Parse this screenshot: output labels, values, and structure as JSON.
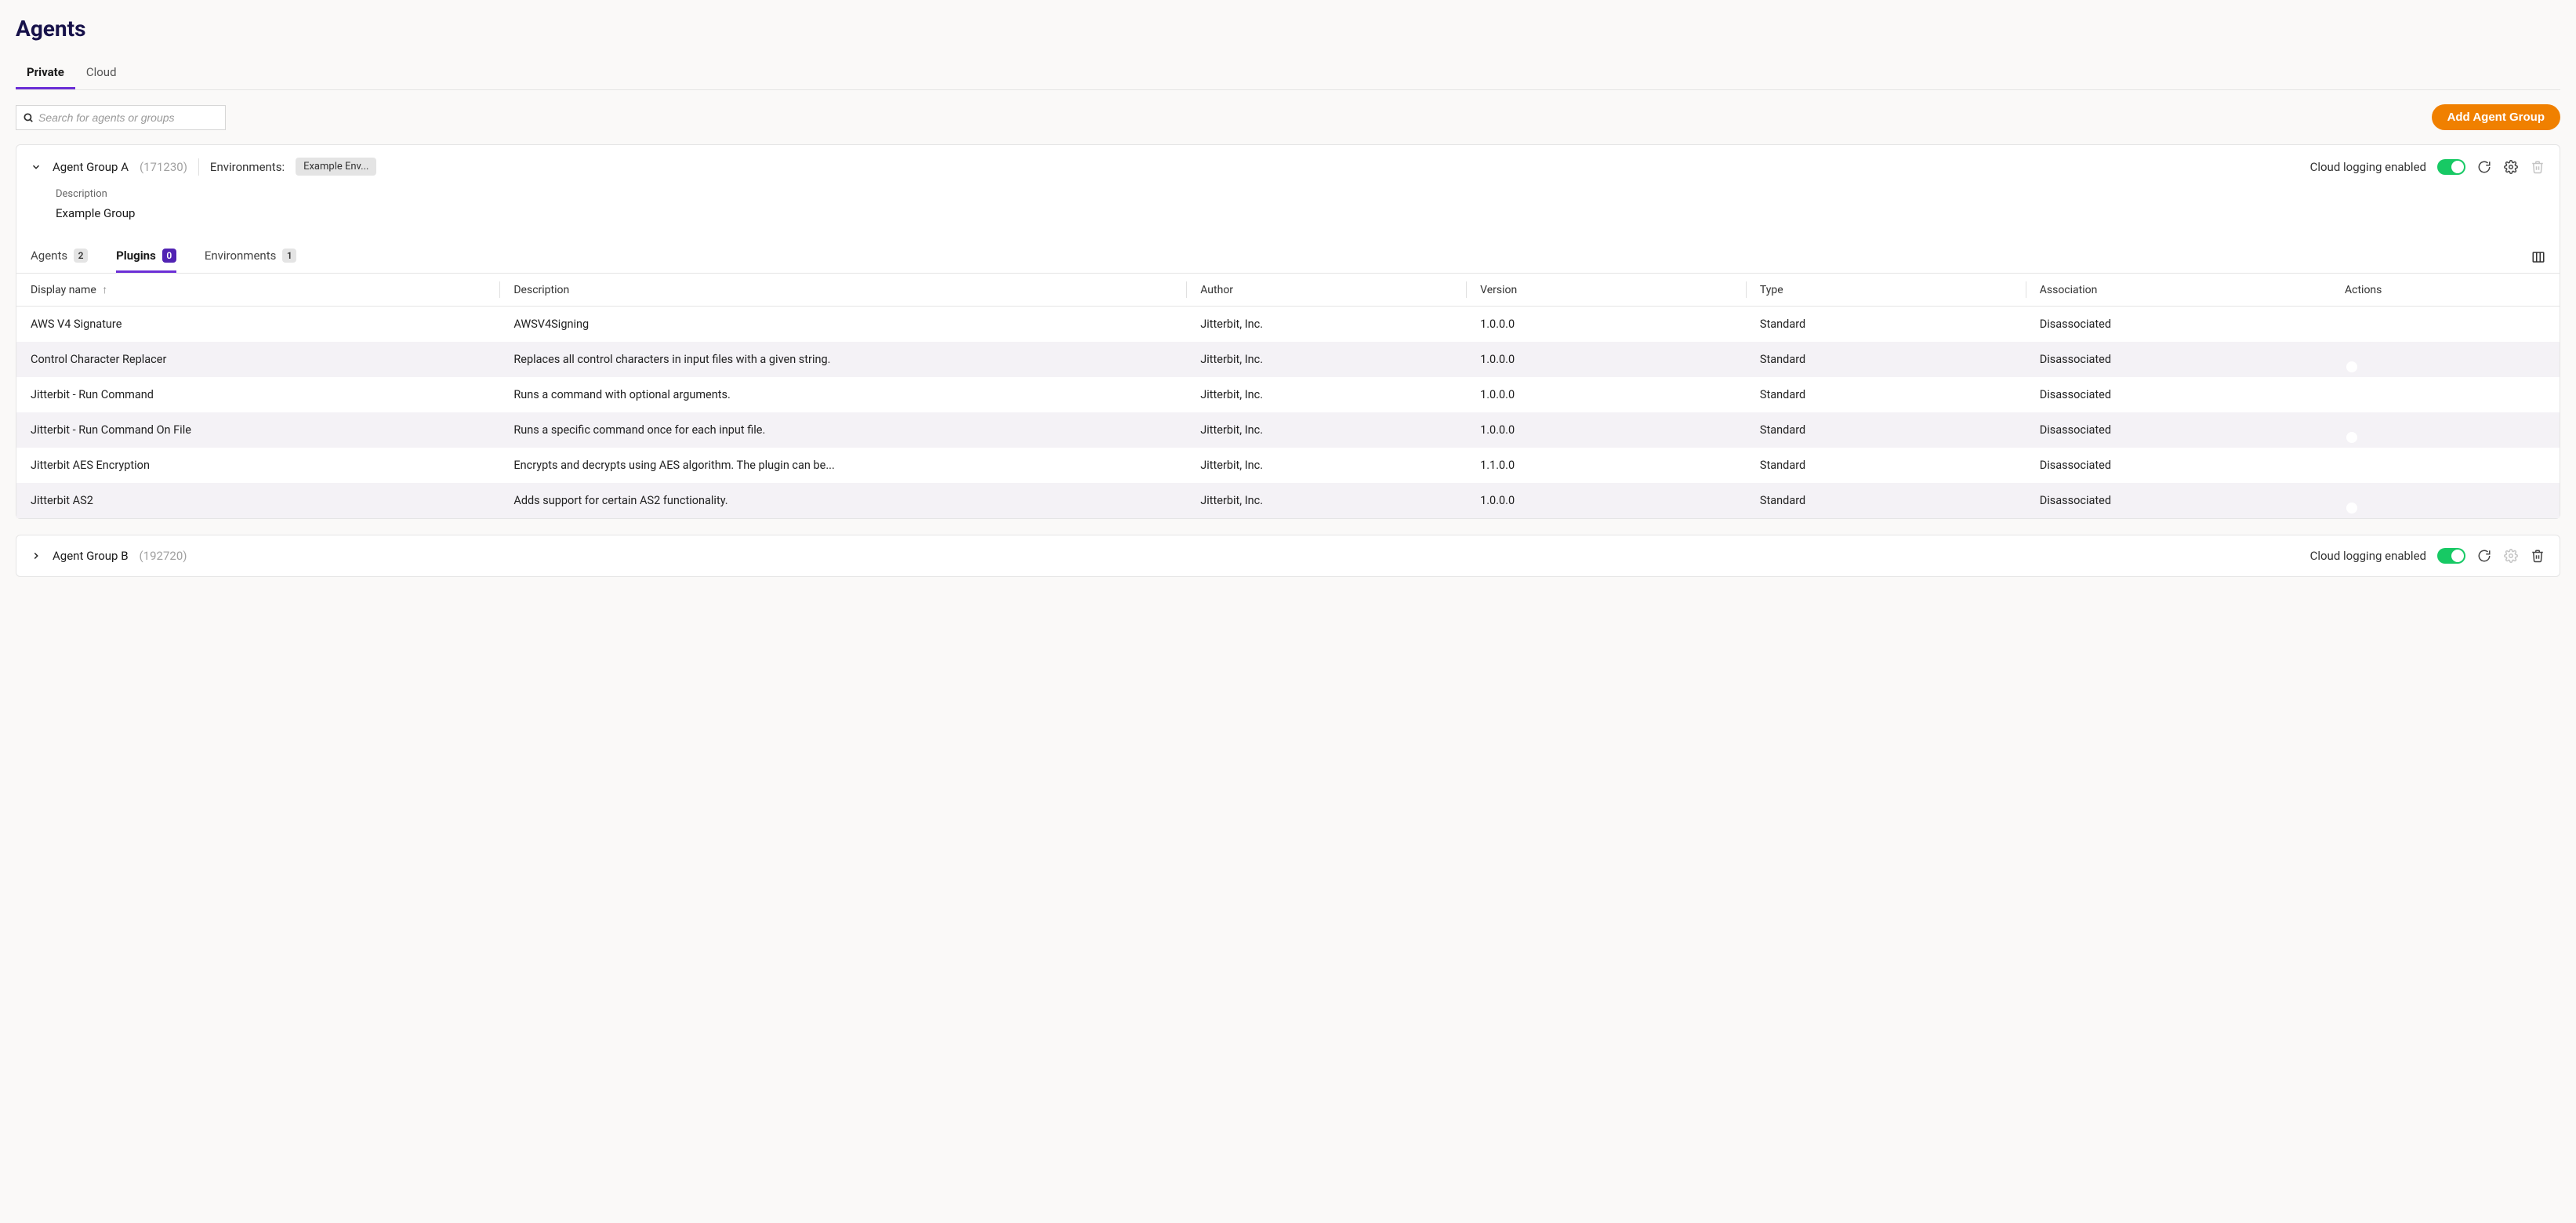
{
  "page_title": "Agents",
  "top_tabs": {
    "private": "Private",
    "cloud": "Cloud"
  },
  "search_placeholder": "Search for agents or groups",
  "add_button_label": "Add Agent Group",
  "group_a": {
    "name": "Agent Group A",
    "id": "(171230)",
    "env_label": "Environments:",
    "env_chip": "Example Env...",
    "cloud_logging_label": "Cloud logging enabled",
    "desc_label": "Description",
    "desc_value": "Example Group",
    "tabs": {
      "agents_label": "Agents",
      "agents_count": "2",
      "plugins_label": "Plugins",
      "plugins_count": "0",
      "env_label": "Environments",
      "env_count": "1"
    },
    "columns": {
      "display_name": "Display name",
      "description": "Description",
      "author": "Author",
      "version": "Version",
      "type": "Type",
      "association": "Association",
      "actions": "Actions"
    },
    "rows": [
      {
        "name": "AWS V4 Signature",
        "desc": "AWSV4Signing",
        "author": "Jitterbit, Inc.",
        "version": "1.0.0.0",
        "type": "Standard",
        "assoc": "Disassociated"
      },
      {
        "name": "Control Character Replacer",
        "desc": "Replaces all control characters in input files with a given string.",
        "author": "Jitterbit, Inc.",
        "version": "1.0.0.0",
        "type": "Standard",
        "assoc": "Disassociated"
      },
      {
        "name": "Jitterbit - Run Command",
        "desc": "Runs a command with optional arguments.",
        "author": "Jitterbit, Inc.",
        "version": "1.0.0.0",
        "type": "Standard",
        "assoc": "Disassociated"
      },
      {
        "name": "Jitterbit - Run Command On File",
        "desc": "Runs a specific command once for each input file.",
        "author": "Jitterbit, Inc.",
        "version": "1.0.0.0",
        "type": "Standard",
        "assoc": "Disassociated"
      },
      {
        "name": "Jitterbit AES Encryption",
        "desc": "Encrypts and decrypts using AES algorithm. The plugin can be...",
        "author": "Jitterbit, Inc.",
        "version": "1.1.0.0",
        "type": "Standard",
        "assoc": "Disassociated"
      },
      {
        "name": "Jitterbit AS2",
        "desc": "Adds support for certain AS2 functionality.",
        "author": "Jitterbit, Inc.",
        "version": "1.0.0.0",
        "type": "Standard",
        "assoc": "Disassociated"
      }
    ]
  },
  "group_b": {
    "name": "Agent Group B",
    "id": "(192720)",
    "cloud_logging_label": "Cloud logging enabled"
  }
}
